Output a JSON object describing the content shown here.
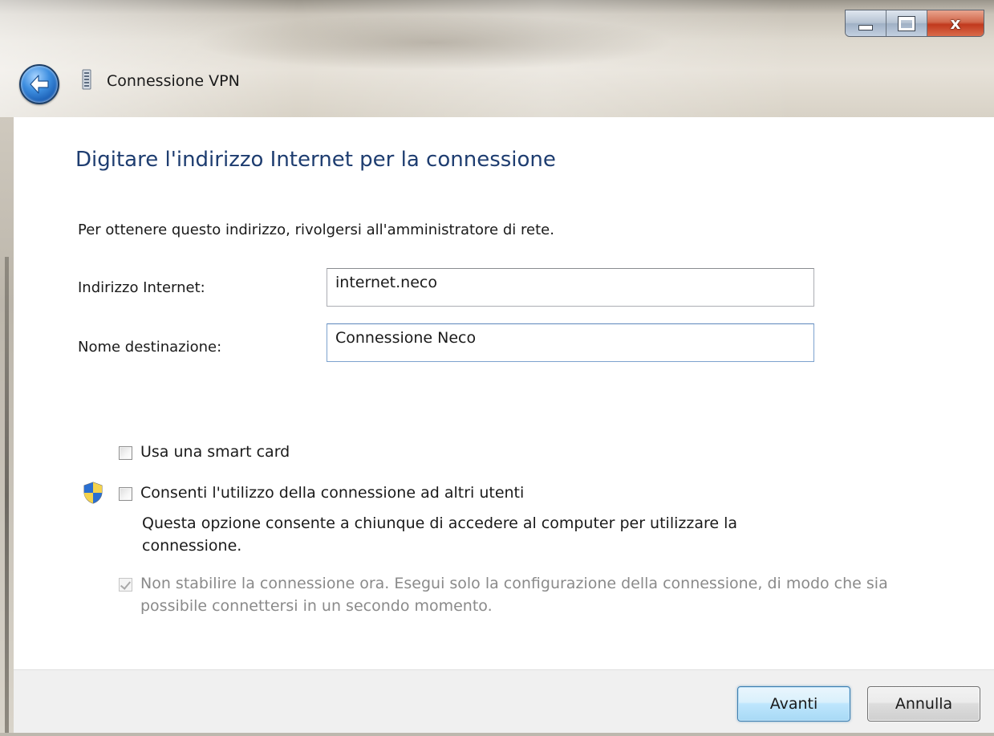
{
  "window": {
    "title": "Connessione VPN",
    "caption_buttons": {
      "minimize_icon": "minimize-icon",
      "maximize_icon": "maximize-icon",
      "close_glyph": "x"
    }
  },
  "nav": {
    "back_icon": "back-arrow-icon",
    "title_icon": "network-icon"
  },
  "content": {
    "heading": "Digitare l'indirizzo Internet per la connessione",
    "instruction": "Per ottenere questo indirizzo, rivolgersi all'amministratore di rete.",
    "fields": {
      "internet_address": {
        "label": "Indirizzo Internet:",
        "value": "internet.neco"
      },
      "destination_name": {
        "label": "Nome destinazione:",
        "value": "Connessione Neco"
      }
    },
    "options": {
      "smart_card": {
        "label": "Usa una smart card",
        "checked": false,
        "enabled": true
      },
      "allow_others": {
        "label": "Consenti l'utilizzo della connessione ad altri utenti",
        "checked": false,
        "enabled": true,
        "icon": "uac-shield-icon",
        "description": "Questa opzione consente a chiunque di accedere al computer per utilizzare la connessione."
      },
      "dont_connect_now": {
        "label": "Non stabilire la connessione ora. Esegui solo la configurazione della connessione, di modo che sia possibile connettersi in un secondo momento.",
        "checked": true,
        "enabled": false
      }
    }
  },
  "footer": {
    "next_label": "Avanti",
    "cancel_label": "Annulla"
  },
  "colors": {
    "heading": "#1e3d70",
    "footer_bg": "#f0f0f0",
    "default_button_border": "#3c7fb1",
    "close_button": "#c1391d"
  }
}
